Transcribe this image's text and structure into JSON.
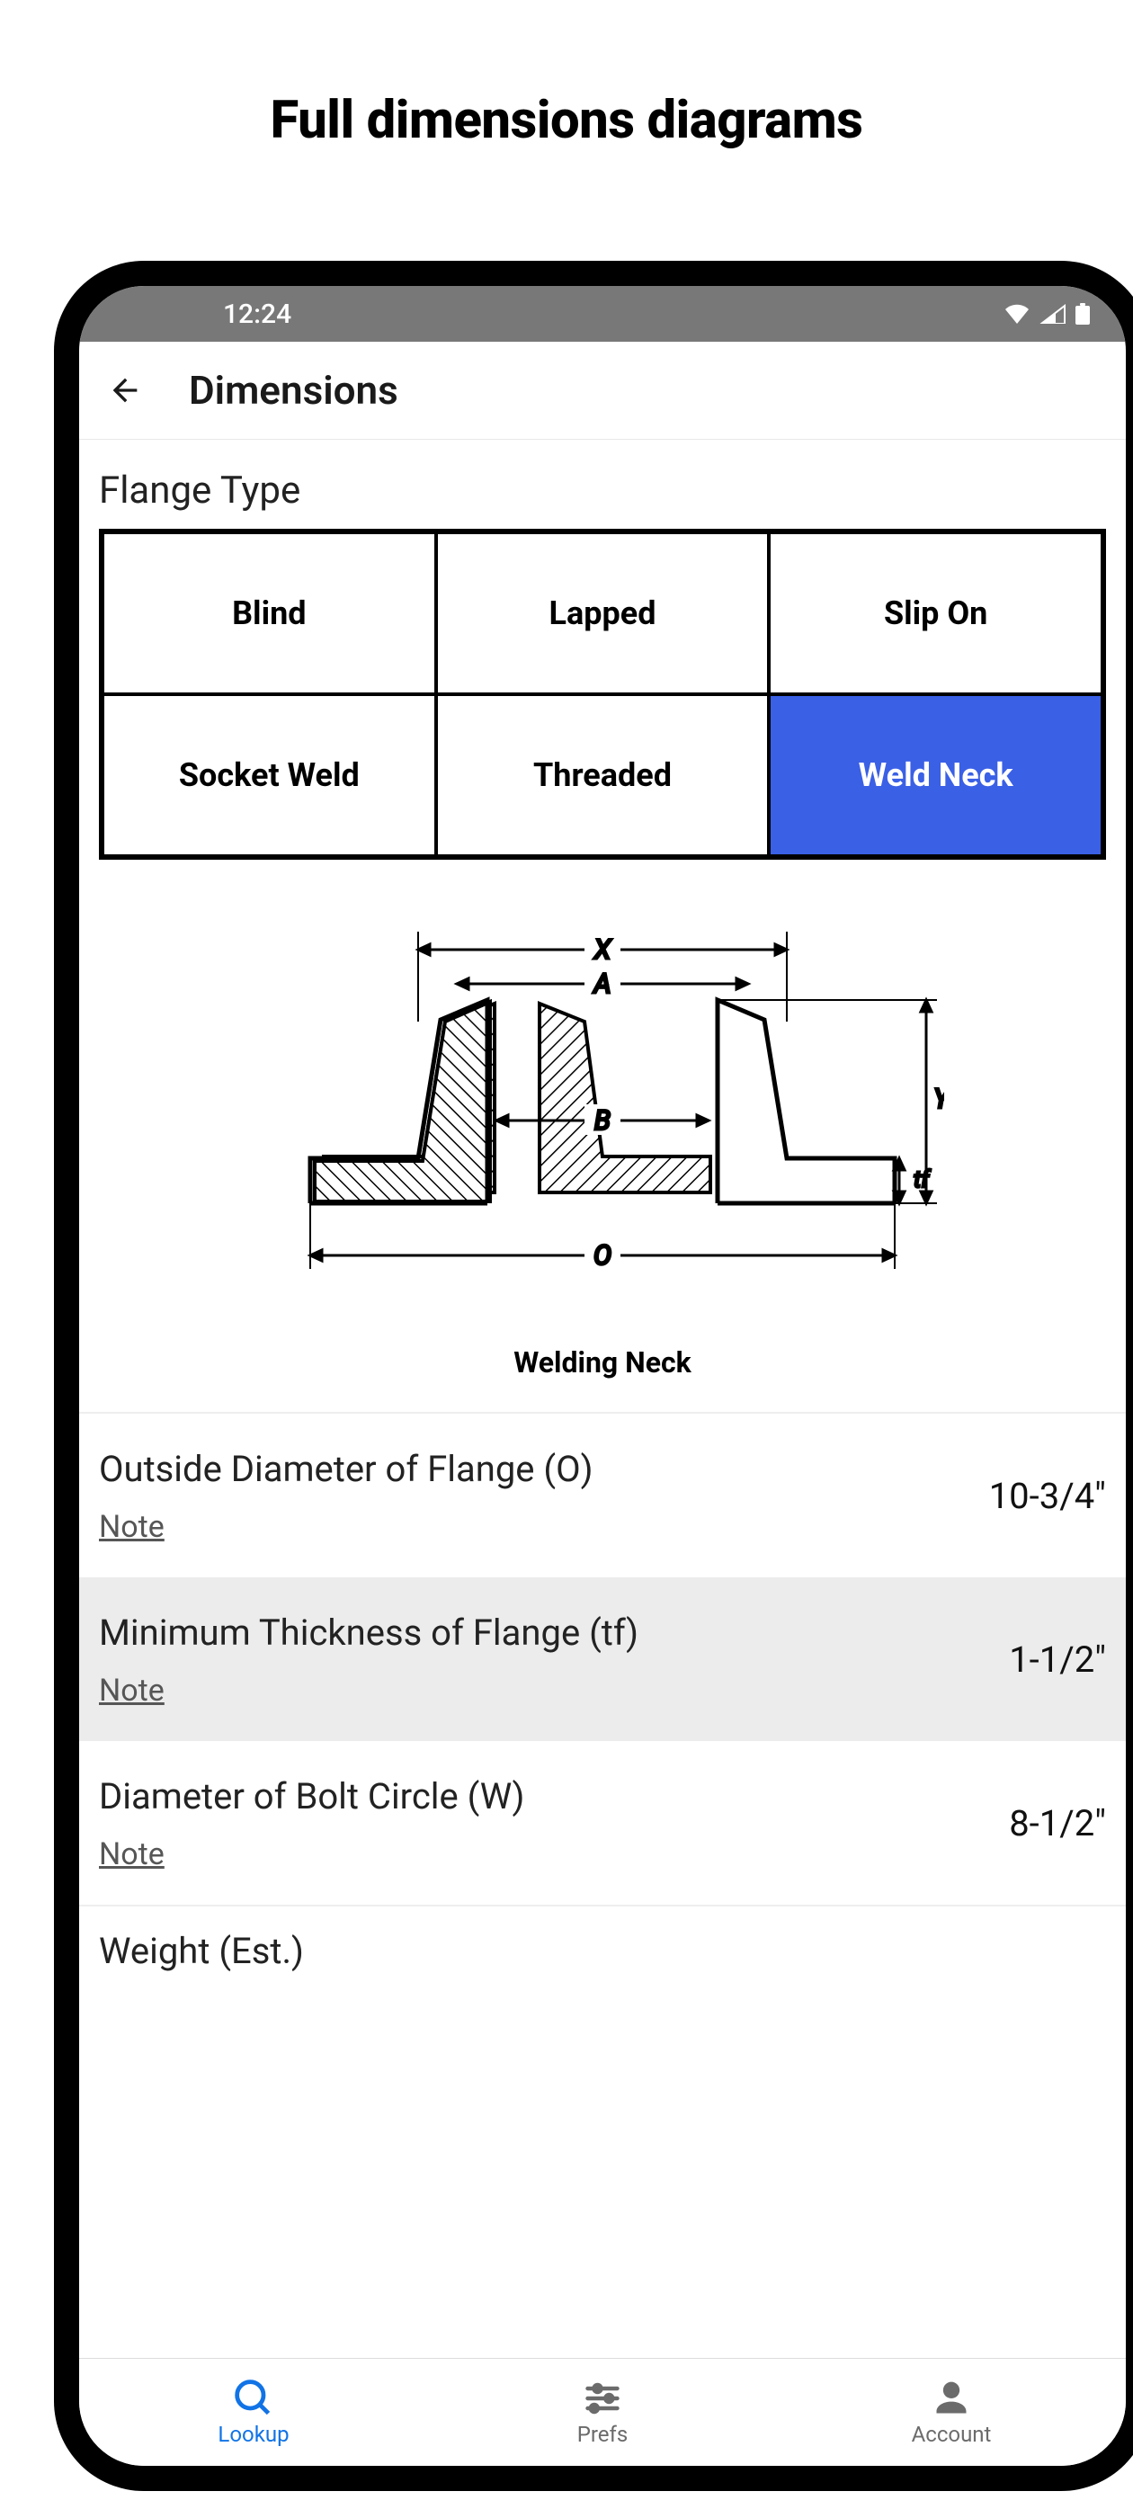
{
  "heading": "Full dimensions diagrams",
  "status": {
    "time": "12:24"
  },
  "appbar": {
    "title": "Dimensions"
  },
  "section": {
    "flange_type_label": "Flange Type"
  },
  "types": {
    "blind": "Blind",
    "lapped": "Lapped",
    "slip_on": "Slip On",
    "socket_weld": "Socket Weld",
    "threaded": "Threaded",
    "weld_neck": "Weld Neck",
    "selected": "weld_neck"
  },
  "diagram": {
    "caption": "Welding Neck",
    "labels": {
      "X": "X",
      "A": "A",
      "B": "B",
      "O": "O",
      "Y": "Y",
      "tf": "tf"
    }
  },
  "rows": [
    {
      "title": "Outside Diameter of Flange (O)",
      "note": "Note",
      "value": "10-3/4\""
    },
    {
      "title": "Minimum Thickness of Flange (tf)",
      "note": "Note",
      "value": "1-1/2\""
    },
    {
      "title": "Diameter of Bolt Circle (W)",
      "note": "Note",
      "value": "8-1/2\""
    }
  ],
  "partial_row": {
    "title": "Weight (Est.)"
  },
  "nav": {
    "lookup": "Lookup",
    "prefs": "Prefs",
    "account": "Account"
  },
  "colors": {
    "accent": "#3a60e6",
    "nav_active": "#1173e6"
  }
}
